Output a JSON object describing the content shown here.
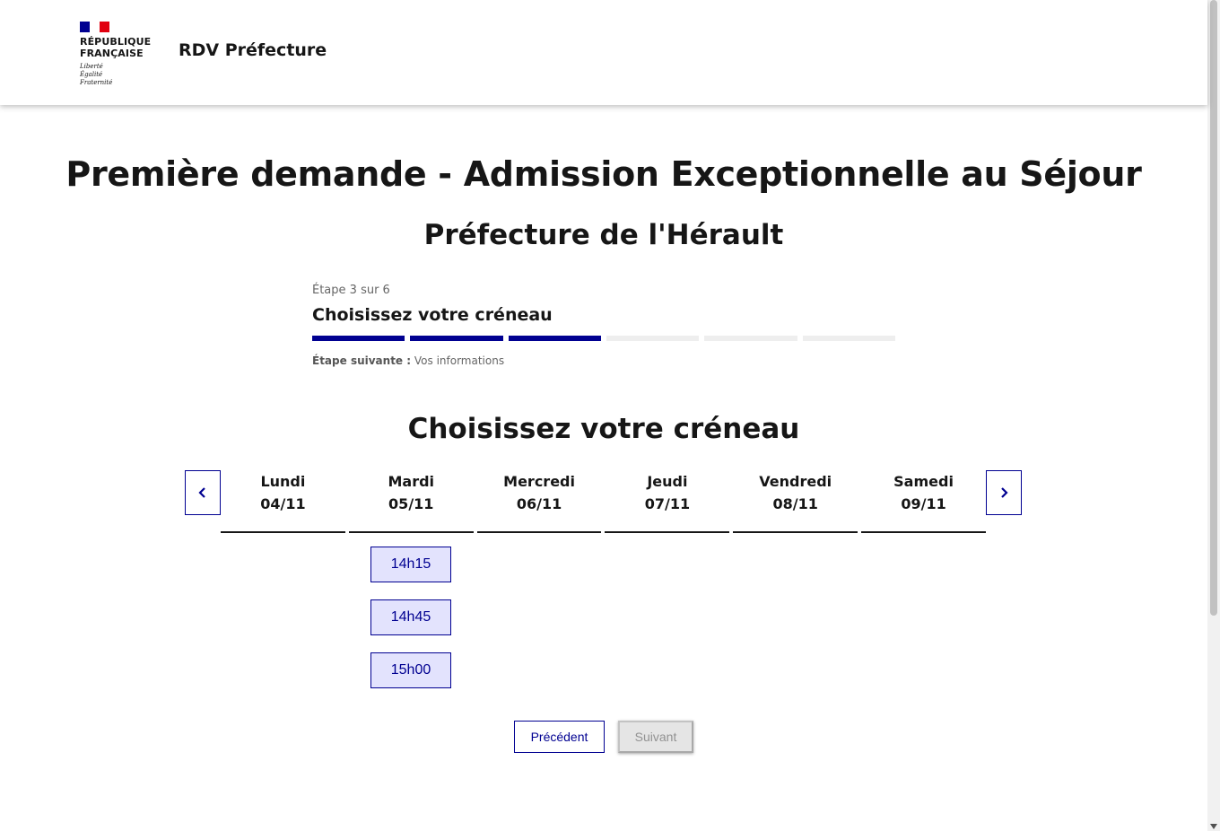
{
  "header": {
    "logo_text": "RÉPUBLIQUE\nFRANÇAISE",
    "motto": "Liberté\nÉgalité\nFraternité",
    "service_title": "RDV Préfecture"
  },
  "page": {
    "title": "Première demande - Admission Exceptionnelle au Séjour",
    "subtitle": "Préfecture de l'Hérault"
  },
  "stepper": {
    "state": "Étape 3 sur 6",
    "title": "Choisissez votre créneau",
    "current_step": 3,
    "total_steps": 6,
    "next_label": "Étape suivante :",
    "next_value": "Vos informations"
  },
  "calendar": {
    "title": "Choisissez votre créneau",
    "prev_label": "Semaine précédente",
    "next_label": "Semaine suivante",
    "days": [
      {
        "name": "Lundi",
        "date": "04/11"
      },
      {
        "name": "Mardi",
        "date": "05/11"
      },
      {
        "name": "Mercredi",
        "date": "06/11"
      },
      {
        "name": "Jeudi",
        "date": "07/11"
      },
      {
        "name": "Vendredi",
        "date": "08/11"
      },
      {
        "name": "Samedi",
        "date": "09/11"
      }
    ],
    "slots_day": "Mardi",
    "slots": [
      "14h15",
      "14h45",
      "15h00"
    ]
  },
  "actions": {
    "previous": "Précédent",
    "next": "Suivant"
  },
  "colors": {
    "primary": "#000091",
    "slot_bg": "#e3e3fd",
    "step_inactive": "#eeeeee",
    "disabled_bg": "#e5e5e5",
    "disabled_text": "#929292"
  }
}
